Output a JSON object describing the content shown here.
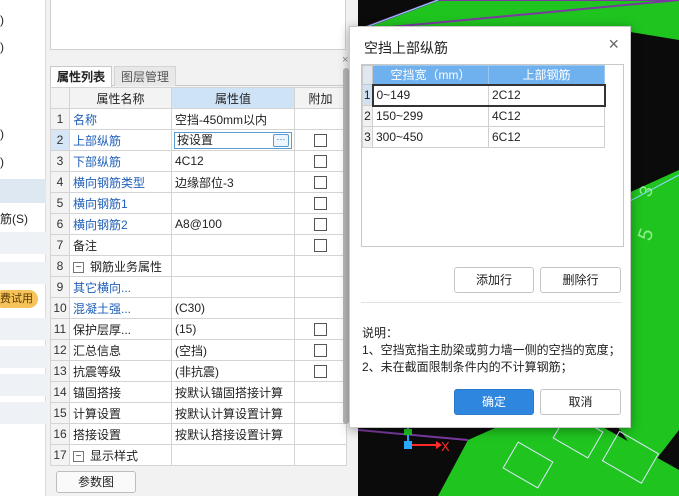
{
  "left_strip": {
    "items": [
      ")",
      ")",
      ")",
      ")",
      "筋(S)"
    ],
    "badge": "费试用"
  },
  "panel": {
    "tabs": [
      "属性列表",
      "图层管理"
    ],
    "close_glyph": "×",
    "columns": {
      "name": "属性名称",
      "value": "属性值",
      "extra": "附加"
    },
    "rows": [
      {
        "num": "1",
        "name": "名称",
        "value": "空挡-450mm以内"
      },
      {
        "num": "2",
        "name": "上部纵筋",
        "value": "按设置"
      },
      {
        "num": "3",
        "name": "下部纵筋",
        "value": "4C12"
      },
      {
        "num": "4",
        "name": "横向钢筋类型",
        "value": "边缘部位-3"
      },
      {
        "num": "5",
        "name": "横向钢筋1",
        "value": ""
      },
      {
        "num": "6",
        "name": "横向钢筋2",
        "value": "A8@100"
      },
      {
        "num": "7",
        "name": "备注",
        "value": ""
      },
      {
        "num": "8",
        "name": "钢筋业务属性",
        "value": ""
      },
      {
        "num": "9",
        "name": "其它横向...",
        "value": ""
      },
      {
        "num": "10",
        "name": "混凝土强...",
        "value": "(C30)"
      },
      {
        "num": "11",
        "name": "保护层厚...",
        "value": "(15)"
      },
      {
        "num": "12",
        "name": "汇总信息",
        "value": "(空挡)"
      },
      {
        "num": "13",
        "name": "抗震等级",
        "value": "(非抗震)"
      },
      {
        "num": "14",
        "name": "锚固搭接",
        "value": "按默认锚固搭接计算"
      },
      {
        "num": "15",
        "name": "计算设置",
        "value": "按默认计算设置计算"
      },
      {
        "num": "16",
        "name": "搭接设置",
        "value": "按默认搭接设置计算"
      },
      {
        "num": "17",
        "name": "显示样式",
        "value": ""
      }
    ],
    "ellipsis": "···",
    "expand_glyph": "−",
    "param_button": "参数图"
  },
  "dialog": {
    "title": "空挡上部纵筋",
    "close_glyph": "×",
    "columns": [
      "空挡宽（mm）",
      "上部钢筋"
    ],
    "rows": [
      {
        "num": "1",
        "range": "0~149",
        "rebar": "2C12"
      },
      {
        "num": "2",
        "range": "150~299",
        "rebar": "4C12"
      },
      {
        "num": "3",
        "range": "300~450",
        "rebar": "6C12"
      }
    ],
    "add_row": "添加行",
    "delete_row": "删除行",
    "note_title": "说明：",
    "notes": [
      "1、空挡宽指主肋梁或剪力墙一侧的空挡的宽度；",
      "2、未在截面限制条件内的不计算钢筋；"
    ],
    "ok": "确定",
    "cancel": "取消"
  },
  "canvas": {
    "axis_x_label": "X",
    "annotations": [
      "3",
      "5"
    ]
  }
}
